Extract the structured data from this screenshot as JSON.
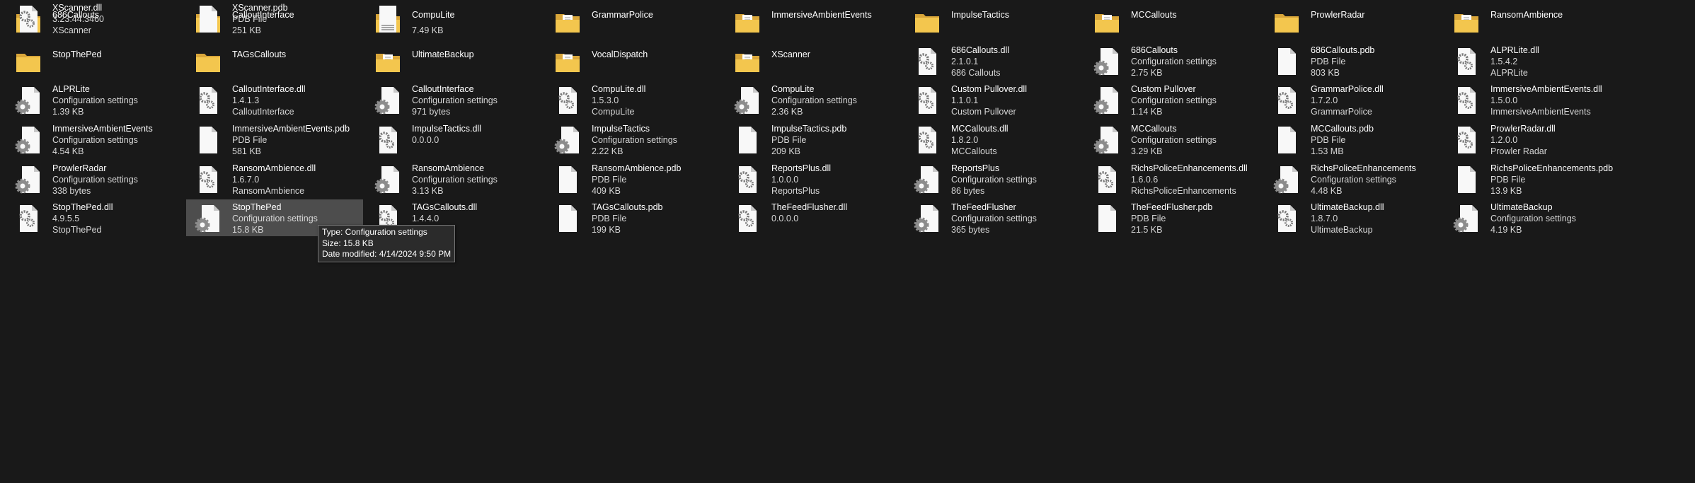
{
  "files": [
    {
      "kind": "folder",
      "lines": [
        "686Callouts"
      ]
    },
    {
      "kind": "folder",
      "lines": [
        "CalloutInterface"
      ]
    },
    {
      "kind": "folder-doc",
      "lines": [
        "CompuLite"
      ]
    },
    {
      "kind": "folder-doc",
      "lines": [
        "GrammarPolice"
      ]
    },
    {
      "kind": "folder-doc",
      "lines": [
        "ImmersiveAmbientEvents"
      ]
    },
    {
      "kind": "folder",
      "lines": [
        "ImpulseTactics"
      ]
    },
    {
      "kind": "folder-doc",
      "lines": [
        "MCCallouts"
      ]
    },
    {
      "kind": "folder",
      "lines": [
        "ProwlerRadar"
      ]
    },
    {
      "kind": "folder-doc",
      "lines": [
        "RansomAmbience"
      ]
    },
    {
      "kind": "folder",
      "lines": [
        "StopThePed"
      ]
    },
    {
      "kind": "folder",
      "lines": [
        "TAGsCallouts"
      ]
    },
    {
      "kind": "folder-doc",
      "lines": [
        "UltimateBackup"
      ]
    },
    {
      "kind": "folder-doc",
      "lines": [
        "VocalDispatch"
      ]
    },
    {
      "kind": "folder-doc",
      "lines": [
        "XScanner"
      ]
    },
    {
      "kind": "dll",
      "lines": [
        "686Callouts.dll",
        "2.1.0.1",
        "686 Callouts"
      ]
    },
    {
      "kind": "config",
      "lines": [
        "686Callouts",
        "Configuration settings",
        "2.75 KB"
      ]
    },
    {
      "kind": "pdb",
      "lines": [
        "686Callouts.pdb",
        "PDB File",
        "803 KB"
      ]
    },
    {
      "kind": "dll",
      "lines": [
        "ALPRLite.dll",
        "1.5.4.2",
        "ALPRLite"
      ]
    },
    {
      "kind": "config",
      "lines": [
        "ALPRLite",
        "Configuration settings",
        "1.39 KB"
      ]
    },
    {
      "kind": "dll",
      "lines": [
        "CalloutInterface.dll",
        "1.4.1.3",
        "CalloutInterface"
      ]
    },
    {
      "kind": "config",
      "lines": [
        "CalloutInterface",
        "Configuration settings",
        "971 bytes"
      ]
    },
    {
      "kind": "dll",
      "lines": [
        "CompuLite.dll",
        "1.5.3.0",
        "CompuLite"
      ]
    },
    {
      "kind": "config",
      "lines": [
        "CompuLite",
        "Configuration settings",
        "2.36 KB"
      ]
    },
    {
      "kind": "dll",
      "lines": [
        "Custom Pullover.dll",
        "1.1.0.1",
        "Custom Pullover"
      ]
    },
    {
      "kind": "config",
      "lines": [
        "Custom Pullover",
        "Configuration settings",
        "1.14 KB"
      ]
    },
    {
      "kind": "dll",
      "lines": [
        "GrammarPolice.dll",
        "1.7.2.0",
        "GrammarPolice"
      ]
    },
    {
      "kind": "dll",
      "lines": [
        "ImmersiveAmbientEvents.dll",
        "1.5.0.0",
        "ImmersiveAmbientEvents"
      ]
    },
    {
      "kind": "config",
      "lines": [
        "ImmersiveAmbientEvents",
        "Configuration settings",
        "4.54 KB"
      ]
    },
    {
      "kind": "pdb",
      "lines": [
        "ImmersiveAmbientEvents.pdb",
        "PDB File",
        "581 KB"
      ]
    },
    {
      "kind": "dll",
      "lines": [
        "ImpulseTactics.dll",
        "0.0.0.0",
        ""
      ]
    },
    {
      "kind": "config",
      "lines": [
        "ImpulseTactics",
        "Configuration settings",
        "2.22 KB"
      ]
    },
    {
      "kind": "pdb",
      "lines": [
        "ImpulseTactics.pdb",
        "PDB File",
        "209 KB"
      ]
    },
    {
      "kind": "dll",
      "lines": [
        "MCCallouts.dll",
        "1.8.2.0",
        "MCCallouts"
      ]
    },
    {
      "kind": "config",
      "lines": [
        "MCCallouts",
        "Configuration settings",
        "3.29 KB"
      ]
    },
    {
      "kind": "pdb",
      "lines": [
        "MCCallouts.pdb",
        "PDB File",
        "1.53 MB"
      ]
    },
    {
      "kind": "dll",
      "lines": [
        "ProwlerRadar.dll",
        "1.2.0.0",
        "Prowler Radar"
      ]
    },
    {
      "kind": "config",
      "lines": [
        "ProwlerRadar",
        "Configuration settings",
        "338 bytes"
      ]
    },
    {
      "kind": "dll",
      "lines": [
        "RansomAmbience.dll",
        "1.6.7.0",
        "RansomAmbience"
      ]
    },
    {
      "kind": "config",
      "lines": [
        "RansomAmbience",
        "Configuration settings",
        "3.13 KB"
      ]
    },
    {
      "kind": "pdb",
      "lines": [
        "RansomAmbience.pdb",
        "PDB File",
        "409 KB"
      ]
    },
    {
      "kind": "dll",
      "lines": [
        "ReportsPlus.dll",
        "1.0.0.0",
        "ReportsPlus"
      ]
    },
    {
      "kind": "config",
      "lines": [
        "ReportsPlus",
        "Configuration settings",
        "86 bytes"
      ]
    },
    {
      "kind": "dll",
      "lines": [
        "RichsPoliceEnhancements.dll",
        "1.6.0.6",
        "RichsPoliceEnhancements"
      ]
    },
    {
      "kind": "config",
      "lines": [
        "RichsPoliceEnhancements",
        "Configuration settings",
        "4.48 KB"
      ]
    },
    {
      "kind": "pdb",
      "lines": [
        "RichsPoliceEnhancements.pdb",
        "PDB File",
        "13.9 KB"
      ]
    },
    {
      "kind": "dll",
      "lines": [
        "StopThePed.dll",
        "4.9.5.5",
        "StopThePed"
      ]
    },
    {
      "kind": "config",
      "lines": [
        "StopThePed",
        "Configuration settings",
        "15.8 KB"
      ],
      "selected": true
    },
    {
      "kind": "dll",
      "lines": [
        "TAGsCallouts.dll",
        "1.4.4.0",
        ""
      ]
    },
    {
      "kind": "pdb",
      "lines": [
        "TAGsCallouts.pdb",
        "PDB File",
        "199 KB"
      ]
    },
    {
      "kind": "dll",
      "lines": [
        "TheFeedFlusher.dll",
        "0.0.0.0",
        ""
      ]
    },
    {
      "kind": "config",
      "lines": [
        "TheFeedFlusher",
        "Configuration settings",
        "365 bytes"
      ]
    },
    {
      "kind": "pdb",
      "lines": [
        "TheFeedFlusher.pdb",
        "PDB File",
        "21.5 KB"
      ]
    },
    {
      "kind": "dll",
      "lines": [
        "UltimateBackup.dll",
        "1.8.7.0",
        "UltimateBackup"
      ]
    },
    {
      "kind": "config",
      "lines": [
        "UltimateBackup",
        "Configuration settings",
        "4.19 KB"
      ]
    },
    {
      "kind": "dll",
      "lines": [
        "XScanner.dll",
        "3.23.44.3460",
        "XScanner"
      ]
    },
    {
      "kind": "pdb",
      "lines": [
        "XScanner.pdb",
        "PDB File",
        "251 KB"
      ]
    },
    {
      "kind": "text",
      "lines": [
        "",
        "",
        "7.49 KB"
      ]
    }
  ],
  "tooltip": {
    "type": "Type: Configuration settings",
    "size": "Size: 15.8 KB",
    "modified": "Date modified: 4/14/2024 9:50 PM"
  }
}
